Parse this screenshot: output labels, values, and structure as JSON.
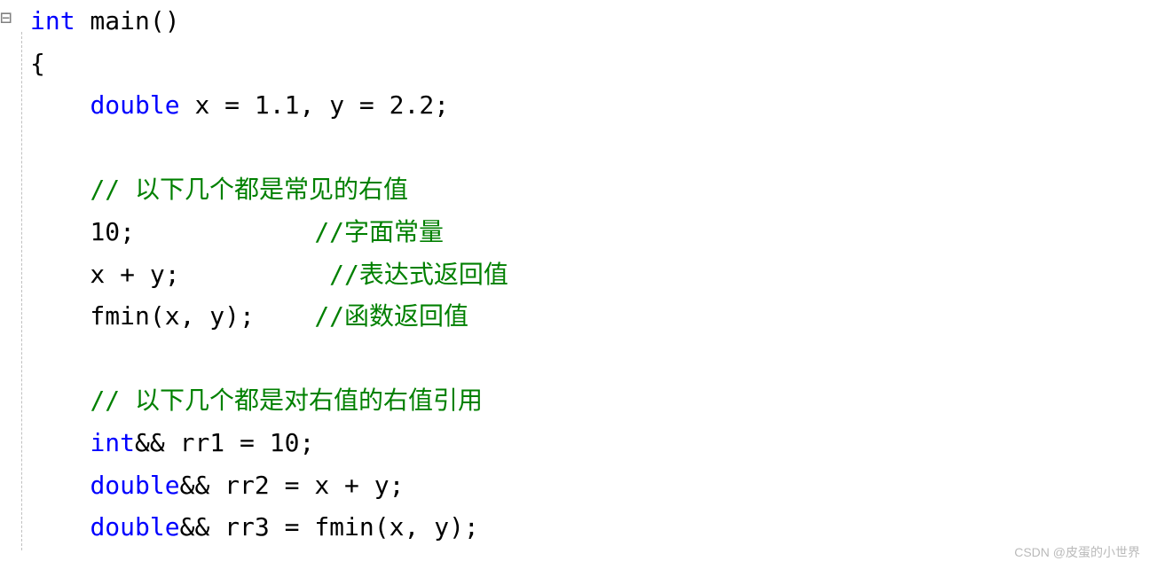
{
  "fold_marker": "⊟",
  "lines": {
    "l1": {
      "t1": "int",
      "t2": " main",
      "t3": "()"
    },
    "l2": {
      "t1": "{"
    },
    "l3": {
      "t1": "    ",
      "t2": "double",
      "t3": " x ",
      "t4": "=",
      "t5": " ",
      "t6": "1.1",
      "t7": ", ",
      "t8": "y ",
      "t9": "=",
      "t10": " ",
      "t11": "2.2",
      "t12": ";"
    },
    "l5": {
      "t1": "    ",
      "t2": "// 以下几个都是常见的右值"
    },
    "l6": {
      "t1": "    ",
      "t2": "10",
      "t3": ";",
      "t4": "            ",
      "t5": "//字面常量"
    },
    "l7": {
      "t1": "    x ",
      "t2": "+",
      "t3": " y",
      "t4": ";",
      "t5": "          ",
      "t6": "//表达式返回值"
    },
    "l8": {
      "t1": "    fmin",
      "t2": "(",
      "t3": "x",
      "t4": ", ",
      "t5": "y",
      "t6": ");",
      "t7": "    ",
      "t8": "//函数返回值"
    },
    "l10": {
      "t1": "    ",
      "t2": "// 以下几个都是对右值的右值引用"
    },
    "l11": {
      "t1": "    ",
      "t2": "int",
      "t3": "&&",
      "t4": " rr1 ",
      "t5": "=",
      "t6": " ",
      "t7": "10",
      "t8": ";"
    },
    "l12": {
      "t1": "    ",
      "t2": "double",
      "t3": "&&",
      "t4": " rr2 ",
      "t5": "=",
      "t6": " x ",
      "t7": "+",
      "t8": " y",
      "t9": ";"
    },
    "l13": {
      "t1": "    ",
      "t2": "double",
      "t3": "&&",
      "t4": " rr3 ",
      "t5": "=",
      "t6": " fmin",
      "t7": "(",
      "t8": "x",
      "t9": ", ",
      "t10": "y",
      "t11": ");"
    }
  },
  "watermark": "CSDN @皮蛋的小世界"
}
